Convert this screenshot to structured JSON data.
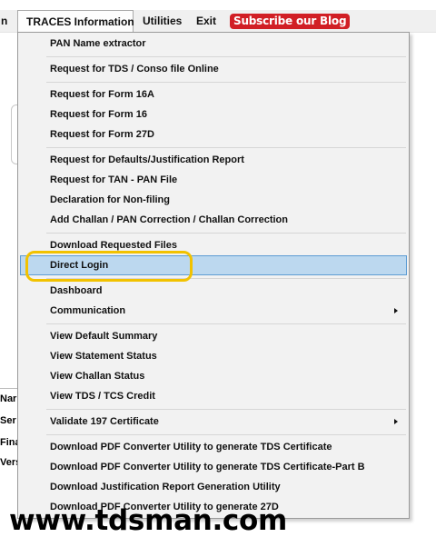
{
  "menubar": {
    "cut_label": "n",
    "traces_label": "TRACES Information",
    "utilities_label": "Utilities",
    "exit_label": "Exit",
    "blog_label": "Subscribe our Blog"
  },
  "background": {
    "labels": [
      "Nar",
      "Ser",
      "Fina",
      "Vers"
    ]
  },
  "menu": {
    "items": [
      {
        "label": "PAN Name extractor"
      },
      {
        "label": "Request for TDS / Conso file Online"
      },
      {
        "label": "Request for Form 16A"
      },
      {
        "label": "Request for Form 16"
      },
      {
        "label": "Request for Form 27D"
      },
      {
        "label": "Request for Defaults/Justification Report"
      },
      {
        "label": "Request for TAN - PAN File"
      },
      {
        "label": "Declaration for Non-filing"
      },
      {
        "label": "Add Challan / PAN Correction / Challan Correction"
      },
      {
        "label": "Download Requested Files"
      },
      {
        "label": "Direct Login",
        "highlighted": true
      },
      {
        "label": "Dashboard"
      },
      {
        "label": "Communication",
        "submenu": true
      },
      {
        "label": "View Default Summary"
      },
      {
        "label": "View Statement Status"
      },
      {
        "label": "View Challan Status"
      },
      {
        "label": "View TDS / TCS Credit"
      },
      {
        "label": "Validate 197 Certificate",
        "submenu": true
      },
      {
        "label": "Download PDF Converter Utility to generate TDS Certificate"
      },
      {
        "label": "Download PDF Converter Utility to generate TDS Certificate-Part B"
      },
      {
        "label": "Download Justification Report Generation Utility"
      },
      {
        "label": "Download PDF Converter Utility to generate 27D"
      }
    ]
  },
  "watermark": "www.tdsman.com",
  "colors": {
    "highlight_fill": "#bcd8ef",
    "highlight_border": "#5d9cd3",
    "annotation_ring": "#f2c200",
    "blog_badge": "#d11f25"
  }
}
